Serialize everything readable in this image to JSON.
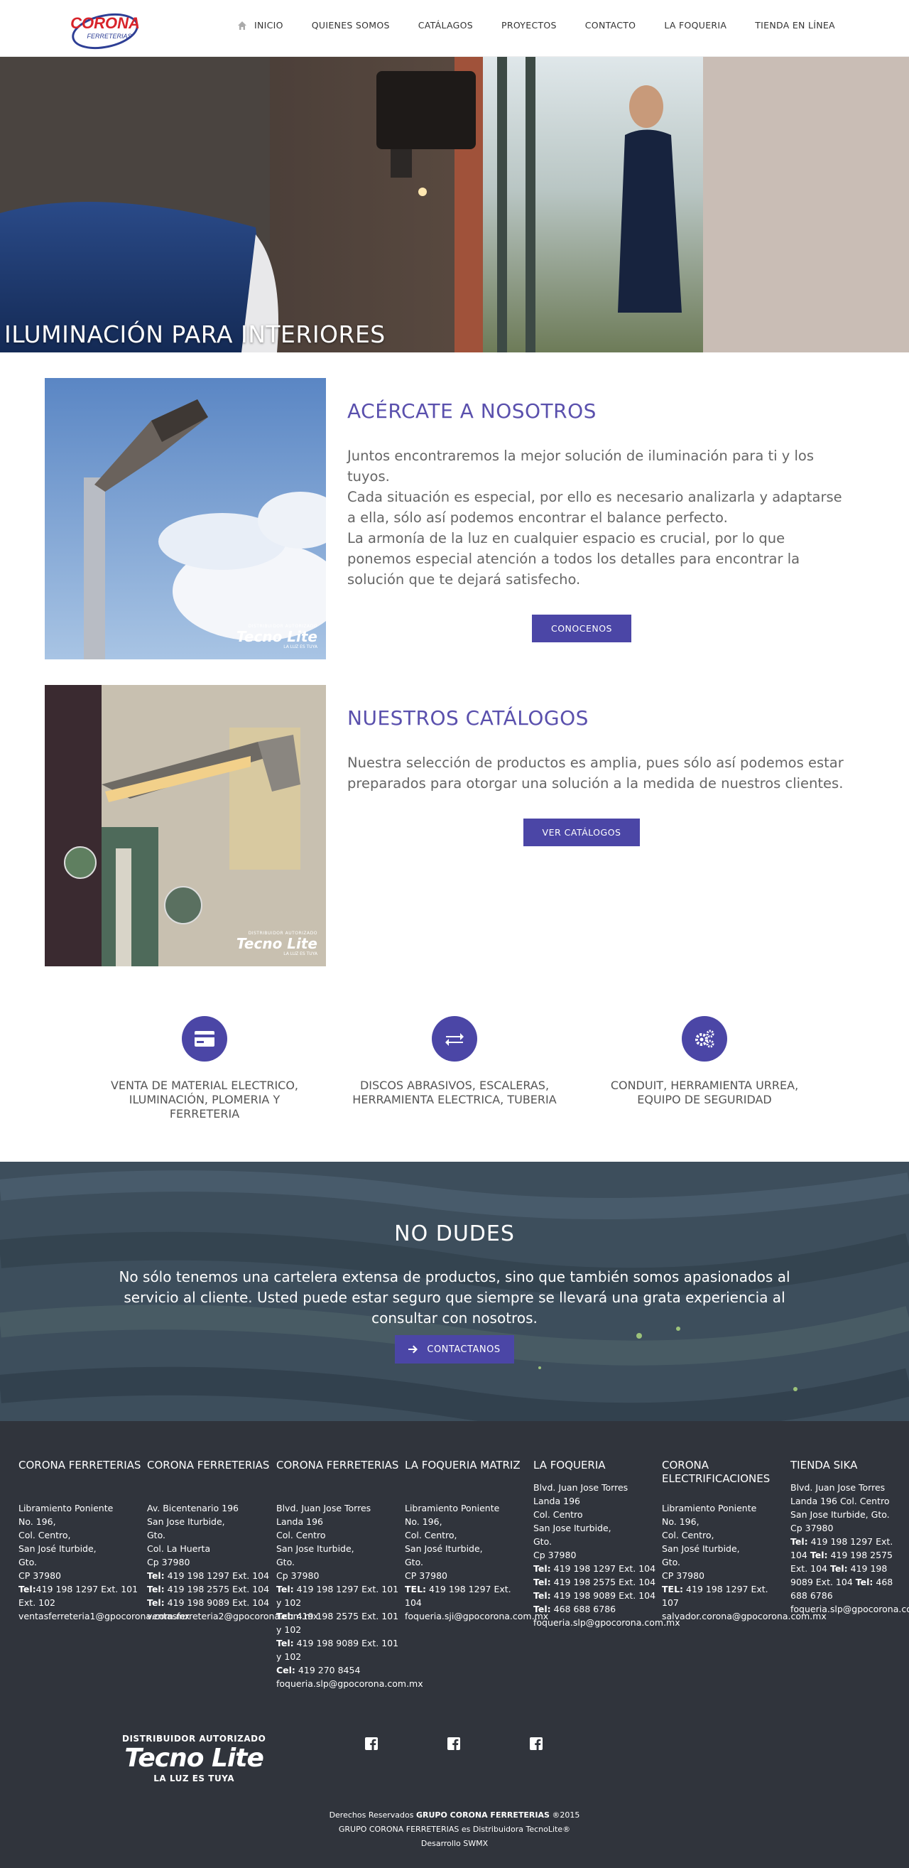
{
  "header": {
    "logo_text": "CORONA",
    "logo_sub": "FERRETERIAS",
    "nav": [
      "INICIO",
      "QUIENES SOMOS",
      "CATÁLAGOS",
      "PROYECTOS",
      "CONTACTO",
      "LA FOQUERIA",
      "TIENDA EN LÍNEA"
    ]
  },
  "hero": {
    "title": "ILUMINACIÓN PARA INTERIORES"
  },
  "about": {
    "title": "ACÉRCATE A NOSOTROS",
    "body": "Juntos encontraremos la mejor solución de iluminación para ti y los tuyos.\nCada situación es especial, por ello es necesario analizarla y adaptarse a ella, sólo así podemos encontrar el balance perfecto.\nLa armonía de la luz en cualquier espacio es crucial, por lo que ponemos especial atención a todos los detalles para encontrar la solución que te dejará satisfecho.",
    "button": "CONOCENOS",
    "watermark": [
      "DISTRIBUIDOR AUTORIZADO",
      "Tecno Lite",
      "LA LUZ ES TUYA"
    ]
  },
  "catalogs": {
    "title": "NUESTROS CATÁLOGOS",
    "body": "Nuestra selección de productos es amplia, pues sólo así podemos estar preparados para otorgar una solución a la medida de nuestros clientes.",
    "button": "VER CATÁLOGOS",
    "watermark": [
      "DISTRIBUIDOR AUTORIZADO",
      "Tecno Lite",
      "LA LUZ ES TUYA"
    ]
  },
  "services": [
    {
      "icon": "credit-card-icon",
      "label": "VENTA DE MATERIAL ELECTRICO, ILUMINACIÓN, PLOMERIA Y FERRETERIA"
    },
    {
      "icon": "exchange-icon",
      "label": "DISCOS ABRASIVOS, ESCALERAS, HERRAMIENTA ELECTRICA, TUBERIA"
    },
    {
      "icon": "gears-icon",
      "label": "CONDUIT, HERRAMIENTA URREA, EQUIPO DE SEGURIDAD"
    }
  ],
  "cta": {
    "title": "NO DUDES",
    "body": "No sólo tenemos una cartelera extensa de productos, sino que también somos apasionados al servicio al cliente. Usted puede estar seguro que siempre se llevará una grata experiencia al consultar con nosotros.",
    "button": "CONTACTANOS"
  },
  "footer": {
    "columns": [
      {
        "title": "CORONA FERRETERIAS",
        "address": "Libramiento Poniente\nNo. 196,\nCol. Centro,\nSan José Iturbide,\nGto.\nCP 37980",
        "tel_label": "Tel:",
        "tel": "419 198 1297 Ext. 101 Ext. 102",
        "email": "ventasferreteria1@gpocorona.com.mx"
      },
      {
        "title": "CORONA FERRETERIAS",
        "address": "Av. Bicentenario 196\nSan Jose Iturbide,\nGto.\nCol. La Huerta\nCp 37980",
        "tel_label": "Tel:",
        "tel": "419 198 1297 Ext. 104",
        "tel2": "419 198 2575 Ext. 104",
        "tel3": "419 198 9089 Ext. 104",
        "email": "ventasferreteria2@gpocorona.com.mx"
      },
      {
        "title": "CORONA FERRETERIAS",
        "address": "Blvd. Juan Jose Torres\nLanda 196\nCol. Centro\nSan Jose Iturbide,\nGto.\nCp 37980",
        "tel_label": "Tel:",
        "tel": "419 198 1297 Ext. 101 y 102",
        "tel2": "419 198 2575 Ext. 101 y 102",
        "tel3": "419 198 9089 Ext. 101 y 102",
        "cel_label": "Cel:",
        "cel": "419 270 8454",
        "email": "foqueria.slp@gpocorona.com.mx"
      },
      {
        "title": "LA FOQUERIA MATRIZ",
        "address": "Libramiento Poniente\nNo. 196,\nCol. Centro,\nSan José Iturbide,\nGto.\nCP 37980",
        "tel_label": "TEL:",
        "tel": "419 198 1297 Ext. 104",
        "email": "foqueria.sji@gpocorona.com.mx"
      },
      {
        "title": "LA FOQUERIA",
        "address": "Blvd. Juan Jose Torres\nLanda 196\nCol. Centro\nSan Jose Iturbide,\nGto.\nCp 37980",
        "tel_label": "Tel:",
        "tel": "419 198 1297 Ext. 104",
        "tel2": "419 198 2575 Ext. 104",
        "tel3": "419 198 9089 Ext. 104",
        "tel4": "468 688 6786",
        "email": "foqueria.slp@gpocorona.com.mx"
      },
      {
        "title": "CORONA ELECTRIFICACIONES",
        "address": "Libramiento Poniente\nNo. 196,\nCol. Centro,\nSan José Iturbide,\nGto.\nCP 37980",
        "tel_label": "TEL:",
        "tel": "419 198 1297 Ext. 107",
        "email": "salvador.corona@gpocorona.com.mx"
      },
      {
        "title": "TIENDA SIKA",
        "address": "Blvd. Juan Jose Torres Landa 196 Col. Centro San Jose Iturbide, Gto. Cp 37980",
        "tel_label": "Tel:",
        "tel": "419 198 1297 Ext. 104",
        "tel2": "419 198 2575 Ext. 104",
        "tel3": "419 198 9089 Ext. 104",
        "tel4": "468 688 6786",
        "email": "foqueria.slp@gpocorona.com.mx"
      }
    ],
    "badge": [
      "DISTRIBUIDOR AUTORIZADO",
      "Tecno Lite",
      "LA LUZ ES TUYA"
    ],
    "social_icons": [
      "facebook-icon",
      "facebook-icon",
      "facebook-icon"
    ],
    "copyright_prefix": "Derechos Reservados ",
    "copyright_brand": "GRUPO CORONA FERRETERIAS",
    "copyright_year": " ®2015",
    "copyright_line2": "GRUPO CORONA FERRETERIAS es Distribuidora TecnoLite®",
    "copyright_line3": "Desarrollo SWMX"
  },
  "colors": {
    "accent": "#4b46a6",
    "heading": "#5a50ad",
    "footer": "#30343c",
    "logo_red": "#d8232a",
    "logo_blue": "#2e3f95"
  }
}
